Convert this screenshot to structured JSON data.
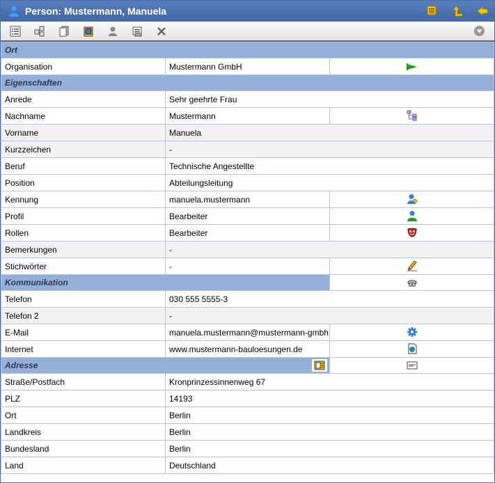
{
  "window": {
    "title": "Person: Mustermann, Manuela"
  },
  "colors": {
    "titlebar": "#4a6fae",
    "section": "#94b0d8",
    "accent_yellow": "#f5c400",
    "link_green": "#1aa01a"
  },
  "sections": {
    "ort": {
      "title": "Ort",
      "rows": [
        {
          "label": "Organisation",
          "value": "Mustermann GmbH",
          "icon": "go-arrow-icon"
        }
      ]
    },
    "eigenschaften": {
      "title": "Eigenschaften",
      "rows": [
        {
          "label": "Anrede",
          "value": "Sehr geehrte Frau"
        },
        {
          "label": "Nachname",
          "value": "Mustermann",
          "icon": "hierarchy-icon"
        },
        {
          "label": "Vorname",
          "value": "Manuela"
        },
        {
          "label": "Kurzzeichen",
          "value": "-"
        },
        {
          "label": "Beruf",
          "value": "Technische Angestellte"
        },
        {
          "label": "Position",
          "value": "Abteilungsleitung"
        },
        {
          "label": "Kennung",
          "value": "manuela.mustermann",
          "icon": "user-key-icon"
        },
        {
          "label": "Profil",
          "value": "Bearbeiter",
          "icon": "user-profile-icon"
        },
        {
          "label": "Rollen",
          "value": "Bearbeiter",
          "icon": "mask-icon"
        },
        {
          "label": "Bemerkungen",
          "value": "-"
        },
        {
          "label": "Stichwörter",
          "value": "-",
          "icon": "pencil-icon"
        }
      ]
    },
    "kommunikation": {
      "title": "Kommunikation",
      "rows": [
        {
          "label": "Telefon",
          "value": "030 555 5555-3"
        },
        {
          "label": "Telefon 2",
          "value": "-"
        },
        {
          "label": "E-Mail",
          "value": "manuela.mustermann@mustermann-gmbh.de",
          "icon": "gear-icon"
        },
        {
          "label": "Internet",
          "value": "www.mustermann-bauloesungen.de",
          "icon": "web-page-icon"
        }
      ]
    },
    "adresse": {
      "title": "Adresse",
      "rows": [
        {
          "label": "Straße/Postfach",
          "value": "Kronprinzessinnenweg 67"
        },
        {
          "label": "PLZ",
          "value": "14193"
        },
        {
          "label": "Ort",
          "value": "Berlin"
        },
        {
          "label": "Landkreis",
          "value": "Berlin"
        },
        {
          "label": "Bundesland",
          "value": "Berlin"
        },
        {
          "label": "Land",
          "value": "Deutschland"
        }
      ]
    }
  }
}
